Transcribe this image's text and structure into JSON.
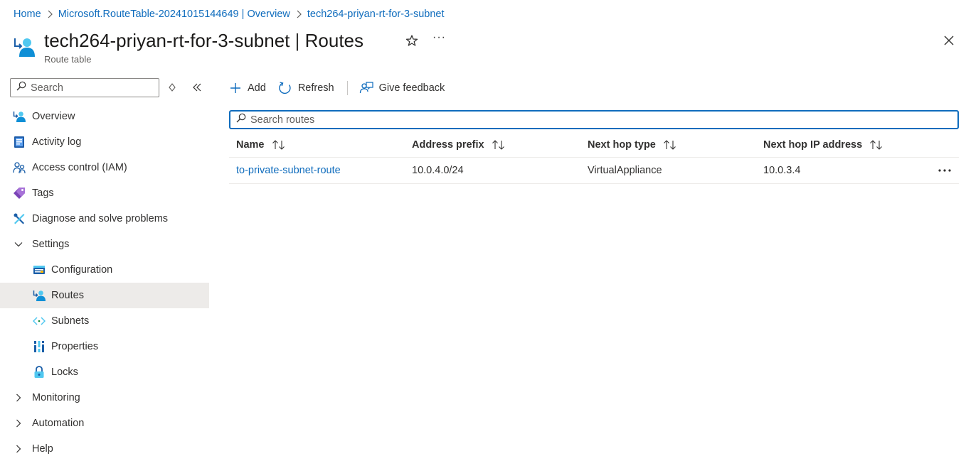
{
  "breadcrumb": {
    "items": [
      "Home",
      "Microsoft.RouteTable-20241015144649 | Overview",
      "tech264-priyan-rt-for-3-subnet"
    ]
  },
  "header": {
    "resource_name": "tech264-priyan-rt-for-3-subnet",
    "separator": "|",
    "page": "Routes",
    "subtitle": "Route table",
    "more": "···"
  },
  "sidebar": {
    "search_placeholder": "Search",
    "items": [
      {
        "label": "Overview",
        "icon": "route-table-icon"
      },
      {
        "label": "Activity log",
        "icon": "activity-log-icon"
      },
      {
        "label": "Access control (IAM)",
        "icon": "iam-icon"
      },
      {
        "label": "Tags",
        "icon": "tag-icon"
      },
      {
        "label": "Diagnose and solve problems",
        "icon": "wrench-icon"
      },
      {
        "label": "Settings",
        "icon": "chevron-down-icon"
      },
      {
        "label": "Configuration",
        "icon": "configuration-icon"
      },
      {
        "label": "Routes",
        "icon": "route-table-icon",
        "active": true
      },
      {
        "label": "Subnets",
        "icon": "subnet-icon"
      },
      {
        "label": "Properties",
        "icon": "properties-icon"
      },
      {
        "label": "Locks",
        "icon": "lock-icon"
      },
      {
        "label": "Monitoring",
        "icon": "chevron-right-icon"
      },
      {
        "label": "Automation",
        "icon": "chevron-right-icon"
      },
      {
        "label": "Help",
        "icon": "chevron-right-icon"
      }
    ]
  },
  "toolbar": {
    "add_label": "Add",
    "refresh_label": "Refresh",
    "feedback_label": "Give feedback"
  },
  "routes_search": {
    "placeholder": "Search routes"
  },
  "table": {
    "columns": [
      "Name",
      "Address prefix",
      "Next hop type",
      "Next hop IP address"
    ],
    "rows": [
      {
        "name": "to-private-subnet-route",
        "address_prefix": "10.0.4.0/24",
        "next_hop_type": "VirtualAppliance",
        "next_hop_ip": "10.0.3.4"
      }
    ]
  },
  "colors": {
    "accent": "#0f6cbd",
    "active_nav_bg": "#edebe9"
  }
}
